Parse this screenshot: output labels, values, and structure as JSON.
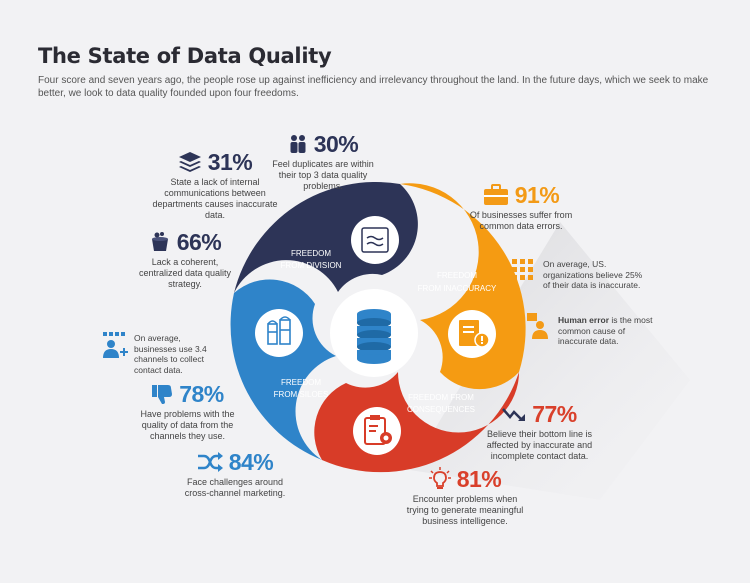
{
  "title": "The State of Data Quality",
  "intro": "Four score and seven years ago, the people rose up against inefficiency and irrelevancy throughout the land. In the future days, which we seek to make better, we look to data quality founded upon four freedoms.",
  "colors": {
    "navy": "#2d3457",
    "orange": "#f39a16",
    "red": "#d9402b",
    "blue": "#2f84c9"
  },
  "segments": {
    "division": {
      "line1": "FREEDOM",
      "line2": "FROM DIVISION",
      "icon": "waves-icon"
    },
    "inaccuracy": {
      "line1": "FREEDOM",
      "line2": "FROM INACCURACY",
      "icon": "warning-document-icon"
    },
    "consequences": {
      "line1": "FREEDOM FROM",
      "line2": "CONSEQUENCES",
      "icon": "clipboard-gear-icon"
    },
    "siloes": {
      "line1": "FREEDOM",
      "line2": "FROM SILOES",
      "icon": "silos-icon"
    },
    "center": {
      "icon": "database-icon"
    }
  },
  "stats": {
    "s30": {
      "value": "30%",
      "desc": "Feel duplicates are within their top 3 data quality problems.",
      "icon": "people-icon"
    },
    "s31": {
      "value": "31%",
      "desc": "State a lack of internal communications between departments causes inaccurate data.",
      "icon": "layers-icon"
    },
    "s66": {
      "value": "66%",
      "desc": "Lack a coherent, centralized data quality strategy.",
      "icon": "bucket-icon"
    },
    "s91": {
      "value": "91%",
      "desc": "Of businesses suffer from common data errors.",
      "icon": "briefcase-icon"
    },
    "s78": {
      "value": "78%",
      "desc": "Have problems with the quality of data from the channels they use.",
      "icon": "thumbs-down-icon"
    },
    "s84": {
      "value": "84%",
      "desc": "Face challenges around cross-channel marketing.",
      "icon": "shuffle-icon"
    },
    "s77": {
      "value": "77%",
      "desc": "Believe their bottom line is affected by inaccurate and incomplete contact data.",
      "icon": "trend-down-icon"
    },
    "s81": {
      "value": "81%",
      "desc": "Encounter problems when trying to generate meaningful business intelligence.",
      "icon": "lightbulb-icon"
    }
  },
  "notes": {
    "grid": {
      "text": "On average, US. organizations believe 25% of their data is inaccurate.",
      "icon": "grid-icon"
    },
    "human": {
      "bold": "Human error",
      "text": " is the most common cause of inaccurate data.",
      "icon": "person-icon"
    },
    "channels": {
      "text": "On average, businesses use 3.4 channels to collect contact data.",
      "icon": "user-add-icon"
    }
  }
}
